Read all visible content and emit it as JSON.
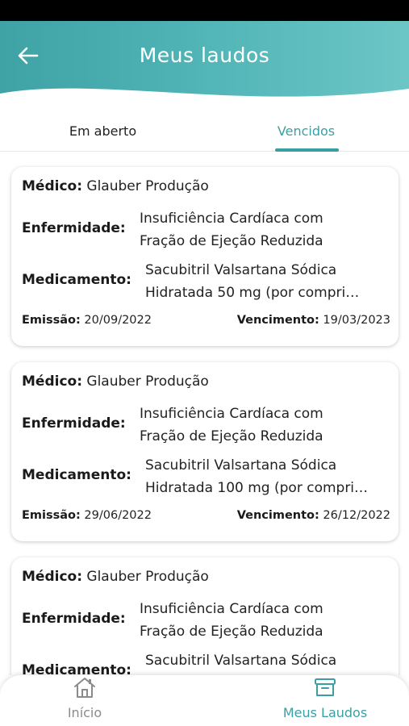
{
  "header": {
    "title": "Meus laudos",
    "back_icon": "arrow-left-icon"
  },
  "tabs": [
    {
      "label": "Em aberto",
      "active": false
    },
    {
      "label": "Vencidos",
      "active": true
    }
  ],
  "labels": {
    "medico": "Médico:",
    "enfermidade": "Enfermidade:",
    "medicamento": "Medicamento:",
    "emissao": "Emissão:",
    "vencimento": "Vencimento:"
  },
  "cards": [
    {
      "medico": "Glauber Produção",
      "enfermidade_l1": "Insuficiência Cardíaca com",
      "enfermidade_l2": "Fração de Ejeção Reduzida",
      "medicamento_l1": "Sacubitril Valsartana Sódica",
      "medicamento_l2": "Hidratada 50 mg (por compri…",
      "emissao": "20/09/2022",
      "vencimento": "19/03/2023"
    },
    {
      "medico": "Glauber Produção",
      "enfermidade_l1": "Insuficiência Cardíaca com",
      "enfermidade_l2": "Fração de Ejeção Reduzida",
      "medicamento_l1": "Sacubitril Valsartana Sódica",
      "medicamento_l2": "Hidratada 100 mg (por compri…",
      "emissao": "29/06/2022",
      "vencimento": "26/12/2022"
    },
    {
      "medico": "Glauber Produção",
      "enfermidade_l1": "Insuficiência Cardíaca com",
      "enfermidade_l2": "Fração de Ejeção Reduzida",
      "medicamento_l1": "Sacubitril Valsartana Sódica",
      "medicamento_l2": "",
      "emissao": "",
      "vencimento": ""
    }
  ],
  "bottom_nav": [
    {
      "label": "Início",
      "icon": "home-icon",
      "active": false
    },
    {
      "label": "Meus Laudos",
      "icon": "archive-box-icon",
      "active": true
    }
  ],
  "colors": {
    "accent": "#3a9fa3",
    "header_start": "#3fa3a6",
    "header_end": "#6cc6c6",
    "inactive": "#8b8b8b"
  }
}
